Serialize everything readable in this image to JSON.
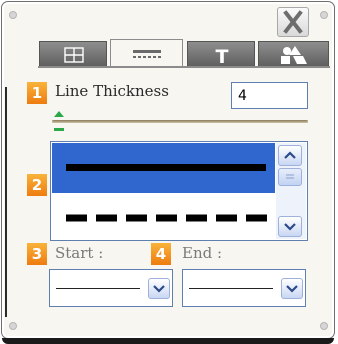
{
  "tabs": [
    {
      "name": "tab-grid",
      "icon": "grid-icon",
      "active": false
    },
    {
      "name": "tab-line",
      "icon": "line-style-icon",
      "active": true
    },
    {
      "name": "tab-text",
      "icon": "text-icon",
      "label": "T",
      "active": false
    },
    {
      "name": "tab-shapes",
      "icon": "shapes-icon",
      "active": false
    }
  ],
  "steps": {
    "one": "1",
    "two": "2",
    "three": "3",
    "four": "4"
  },
  "thickness": {
    "label": "Line Thickness",
    "value": "4"
  },
  "line_styles": [
    {
      "style": "solid",
      "selected": true
    },
    {
      "style": "dashed",
      "selected": false
    }
  ],
  "start": {
    "label": "Start :"
  },
  "end": {
    "label": "End :"
  },
  "colors": {
    "accent": "#2f67cf",
    "badge": "#ee7c10",
    "slider": "#2aa84a"
  }
}
